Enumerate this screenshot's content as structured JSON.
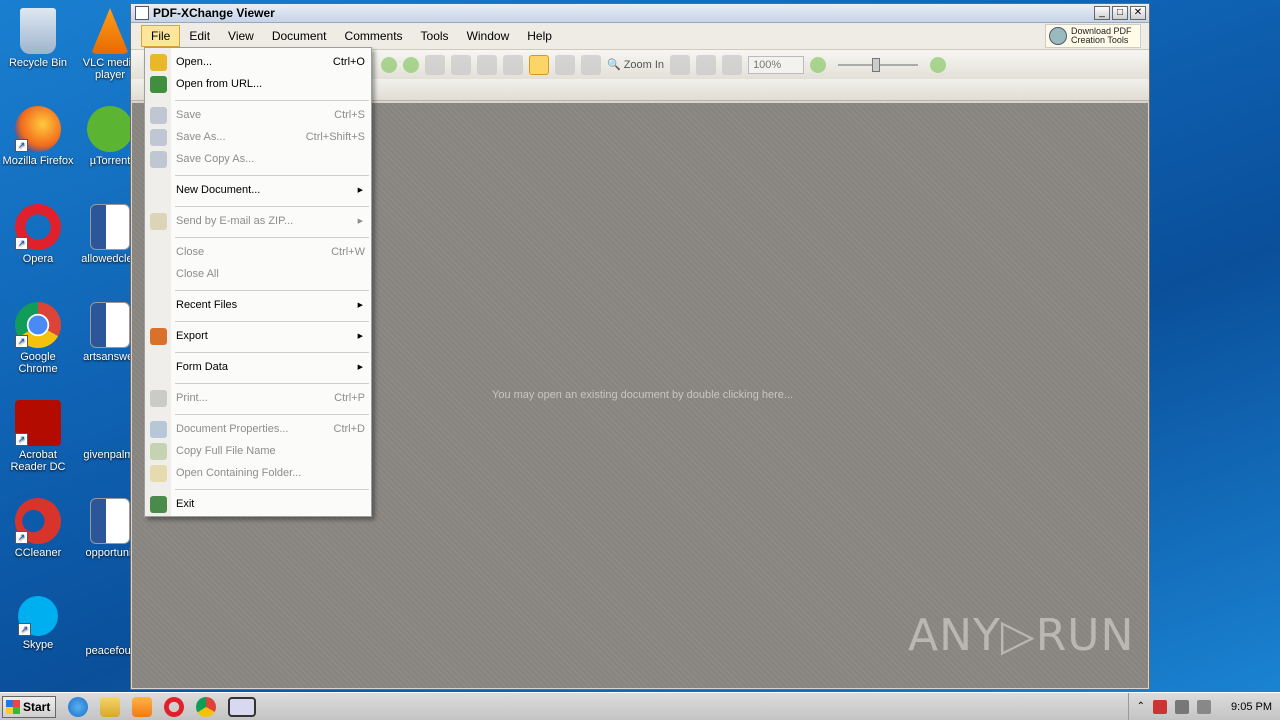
{
  "desktop": {
    "col1": [
      "Recycle Bin",
      "Mozilla Firefox",
      "Opera",
      "Google Chrome",
      "Acrobat Reader DC",
      "CCleaner",
      "Skype"
    ],
    "col2": [
      "VLC media player",
      "µTorrent",
      "allowedclea",
      "artsanswer",
      "givenpalm.",
      "opportunit",
      "peacefour"
    ]
  },
  "window": {
    "title": "PDF-XChange Viewer",
    "buttons": [
      "_",
      "□",
      "✕"
    ],
    "menu": [
      "File",
      "Edit",
      "View",
      "Document",
      "Comments",
      "Tools",
      "Window",
      "Help"
    ],
    "promo": [
      "Download PDF",
      "Creation Tools"
    ],
    "zoom_in_label": "Zoom In",
    "zoom_value": "100%",
    "hint": "You may open an existing document by double clicking here..."
  },
  "file_menu": [
    {
      "label": "Open...",
      "shortcut": "Ctrl+O",
      "enabled": true,
      "icon": "open-folder-icon",
      "color": "#e8b82a"
    },
    {
      "label": "Open from URL...",
      "shortcut": "",
      "enabled": true,
      "icon": "globe-icon",
      "color": "#3f8f3f"
    },
    {
      "label": "Save",
      "shortcut": "Ctrl+S",
      "enabled": false,
      "icon": "save-icon",
      "color": "#6a7fa8"
    },
    {
      "label": "Save As...",
      "shortcut": "Ctrl+Shift+S",
      "enabled": false,
      "icon": "save-as-icon",
      "color": "#6a7fa8"
    },
    {
      "label": "Save Copy As...",
      "shortcut": "",
      "enabled": false,
      "icon": "save-copy-icon",
      "color": "#6a7fa8"
    },
    {
      "label": "New Document...",
      "shortcut": "",
      "enabled": true,
      "submenu": true,
      "icon": "",
      "color": ""
    },
    {
      "label": "Send by E-mail as ZIP...",
      "shortcut": "",
      "enabled": false,
      "submenu": true,
      "icon": "email-zip-icon",
      "color": "#b9a25a"
    },
    {
      "label": "Close",
      "shortcut": "Ctrl+W",
      "enabled": false,
      "icon": "",
      "color": ""
    },
    {
      "label": "Close All",
      "shortcut": "",
      "enabled": false,
      "icon": "",
      "color": ""
    },
    {
      "label": "Recent Files",
      "shortcut": "",
      "enabled": true,
      "submenu": true,
      "icon": "",
      "color": ""
    },
    {
      "label": "Export",
      "shortcut": "",
      "enabled": true,
      "submenu": true,
      "icon": "export-icon",
      "color": "#d9702c"
    },
    {
      "label": "Form Data",
      "shortcut": "",
      "enabled": true,
      "submenu": true,
      "icon": "",
      "color": ""
    },
    {
      "label": "Print...",
      "shortcut": "Ctrl+P",
      "enabled": false,
      "icon": "printer-icon",
      "color": "#888888"
    },
    {
      "label": "Document Properties...",
      "shortcut": "Ctrl+D",
      "enabled": false,
      "icon": "properties-icon",
      "color": "#4d7fb5"
    },
    {
      "label": "Copy Full File Name",
      "shortcut": "",
      "enabled": false,
      "icon": "copy-name-icon",
      "color": "#7aa04a"
    },
    {
      "label": "Open Containing Folder...",
      "shortcut": "",
      "enabled": false,
      "icon": "folder-icon",
      "color": "#d8b840"
    },
    {
      "label": "Exit",
      "shortcut": "",
      "enabled": true,
      "icon": "exit-icon",
      "color": "#4a8a4a"
    }
  ],
  "taskbar": {
    "start_label": "Start",
    "clock": "9:05 PM"
  },
  "watermark": "ANY▷RUN"
}
